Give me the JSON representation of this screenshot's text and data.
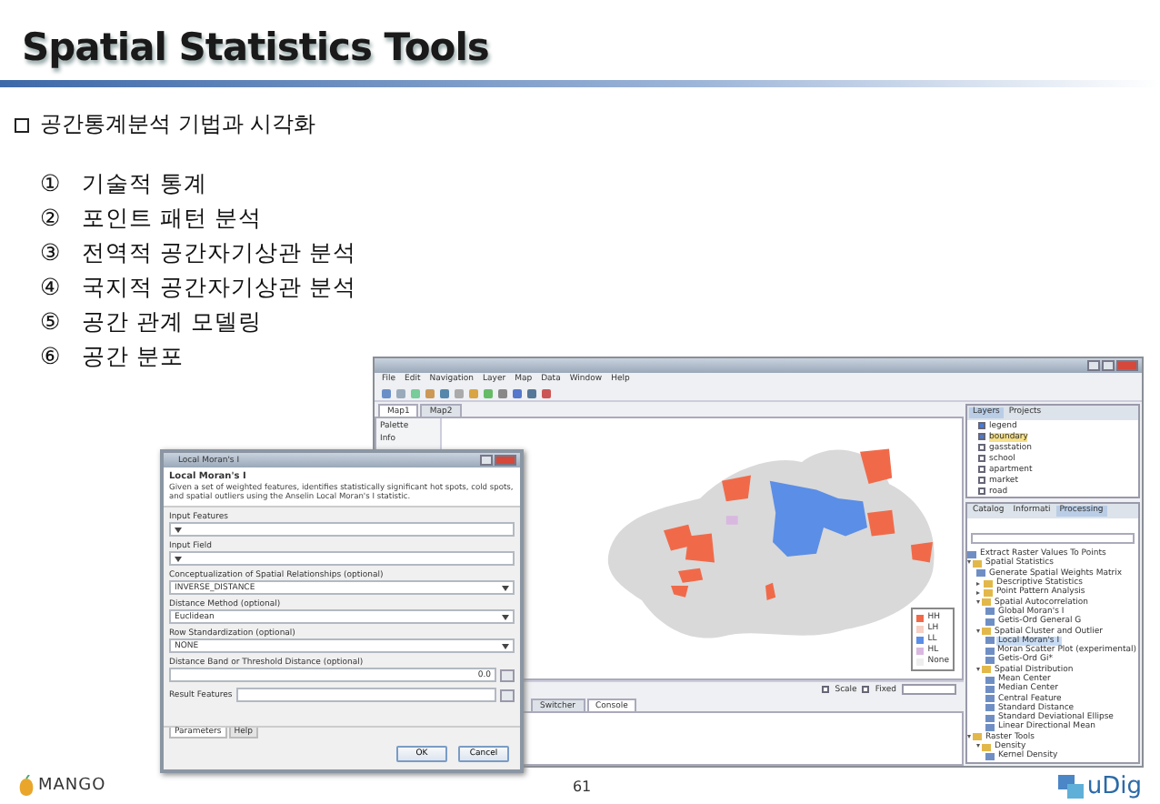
{
  "slide": {
    "title": "Spatial Statistics Tools",
    "heading": "공간통계분석 기법과 시각화",
    "items": [
      {
        "number": "①",
        "label": "기술적 통계"
      },
      {
        "number": "②",
        "label": "포인트 패턴 분석"
      },
      {
        "number": "③",
        "label": "전역적 공간자기상관 분석"
      },
      {
        "number": "④",
        "label": "국지적 공간자기상관 분석"
      },
      {
        "number": "⑤",
        "label": "공간 관계 모델링"
      },
      {
        "number": "⑥",
        "label": "공간 분포"
      }
    ],
    "page_number": "61",
    "logo_left": "MANGO",
    "logo_right": "uDig"
  },
  "app_window": {
    "menu": [
      "File",
      "Edit",
      "Navigation",
      "Layer",
      "Map",
      "Data",
      "Window",
      "Help"
    ],
    "map_tabs": [
      {
        "label": "Map1",
        "selected": true
      },
      {
        "label": "Map2",
        "selected": false
      }
    ],
    "palette": "Palette",
    "info": "Info",
    "layer_tabs": [
      {
        "label": "Layers",
        "selected": true
      },
      {
        "label": "Projects",
        "selected": false
      }
    ],
    "layers": [
      {
        "label": "legend",
        "checked": true,
        "selected": false
      },
      {
        "label": "boundary",
        "checked": true,
        "selected": true
      },
      {
        "label": "gasstation",
        "checked": false,
        "selected": false
      },
      {
        "label": "school",
        "checked": false,
        "selected": false
      },
      {
        "label": "apartment",
        "checked": false,
        "selected": false
      },
      {
        "label": "market",
        "checked": false,
        "selected": false
      },
      {
        "label": "road",
        "checked": false,
        "selected": false
      }
    ],
    "tool_tabs": [
      {
        "label": "Catalog",
        "selected": false
      },
      {
        "label": "Informati",
        "selected": false
      },
      {
        "label": "Processing",
        "selected": true
      }
    ],
    "tree": [
      {
        "label": "Extract Raster Values To Points",
        "kind": "tool",
        "selected": false
      },
      {
        "label": "Spatial Statistics",
        "kind": "folder",
        "expanded": true,
        "selected": false,
        "children": [
          {
            "label": "Generate Spatial Weights Matrix",
            "kind": "tool",
            "selected": false
          },
          {
            "label": "Descriptive Statistics",
            "kind": "folder",
            "expanded": false,
            "selected": false
          },
          {
            "label": "Point Pattern Analysis",
            "kind": "folder",
            "expanded": false,
            "selected": false
          },
          {
            "label": "Spatial Autocorrelation",
            "kind": "folder",
            "expanded": true,
            "selected": false,
            "children": [
              {
                "label": "Global Moran's I",
                "kind": "tool",
                "selected": false
              },
              {
                "label": "Getis-Ord General G",
                "kind": "tool",
                "selected": false
              }
            ]
          },
          {
            "label": "Spatial Cluster and Outlier",
            "kind": "folder",
            "expanded": true,
            "selected": false,
            "children": [
              {
                "label": "Local Moran's I",
                "kind": "tool",
                "selected": true
              },
              {
                "label": "Moran Scatter Plot (experimental)",
                "kind": "tool",
                "selected": false
              },
              {
                "label": "Getis-Ord Gi*",
                "kind": "tool",
                "selected": false
              }
            ]
          },
          {
            "label": "Spatial Distribution",
            "kind": "folder",
            "expanded": true,
            "selected": false,
            "children": [
              {
                "label": "Mean Center",
                "kind": "tool",
                "selected": false
              },
              {
                "label": "Median Center",
                "kind": "tool",
                "selected": false
              },
              {
                "label": "Central Feature",
                "kind": "tool",
                "selected": false
              },
              {
                "label": "Standard Distance",
                "kind": "tool",
                "selected": false
              },
              {
                "label": "Standard Deviational Ellipse",
                "kind": "tool",
                "selected": false
              },
              {
                "label": "Linear Directional Mean",
                "kind": "tool",
                "selected": false
              }
            ]
          }
        ]
      },
      {
        "label": "Raster Tools",
        "kind": "folder",
        "expanded": true,
        "selected": false,
        "children": [
          {
            "label": "Density",
            "kind": "folder",
            "expanded": true,
            "selected": false,
            "children": [
              {
                "label": "Kernel Density",
                "kind": "tool",
                "selected": false
              }
            ]
          }
        ]
      }
    ],
    "legend": [
      {
        "label": "HH",
        "color": "#f06a4a"
      },
      {
        "label": "LH",
        "color": "#f6d0c4"
      },
      {
        "label": "LL",
        "color": "#5b8ee6"
      },
      {
        "label": "HL",
        "color": "#d9b8e0"
      },
      {
        "label": "None",
        "color": "#eeeeee"
      }
    ],
    "status": {
      "scale_label": "Scale",
      "scale_checked": false,
      "fixed_label": "Fixed",
      "fixed_checked": false
    },
    "bottom_tabs": [
      {
        "label": "Switcher",
        "selected": false
      },
      {
        "label": "Console",
        "selected": true
      }
    ]
  },
  "dialog": {
    "title": "Local Moran's I",
    "heading": "Local Moran's I",
    "description": "Given a set of weighted features, identifies statistically significant hot spots, cold spots, and spatial outliers using the Anselin Local Moran's I statistic.",
    "fields": [
      {
        "label": "Input Features",
        "kind": "dropdown"
      },
      {
        "label": "Input Field",
        "kind": "dropdown"
      },
      {
        "label": "Conceptualization of Spatial Relationships (optional)",
        "kind": "dropdown",
        "value": "INVERSE_DISTANCE"
      },
      {
        "label": "Distance Method (optional)",
        "kind": "dropdown",
        "value": "Euclidean"
      },
      {
        "label": "Row Standardization (optional)",
        "kind": "dropdown",
        "value": "NONE"
      },
      {
        "label": "Distance Band or Threshold Distance (optional)",
        "kind": "number",
        "value": "0.0"
      },
      {
        "label": "Result Features",
        "kind": "file"
      }
    ],
    "tabs": [
      {
        "label": "Parameters",
        "selected": true
      },
      {
        "label": "Help",
        "selected": false
      }
    ],
    "buttons": [
      "OK",
      "Cancel"
    ]
  }
}
